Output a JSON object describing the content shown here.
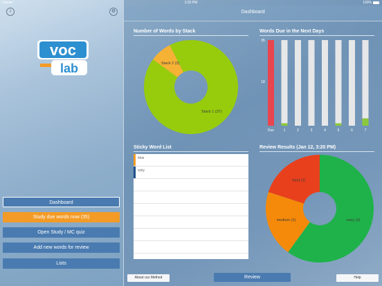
{
  "status": {
    "carrier": "Carrier",
    "time": "3:20 PM",
    "battery": "100%"
  },
  "sidebar": {
    "buttons": [
      {
        "label": "Dashboard",
        "style": "dash"
      },
      {
        "label": "Study due words now (35)",
        "style": "orange"
      },
      {
        "label": "Open Study / MC quiz",
        "style": "blue"
      },
      {
        "label": "Add new words for review",
        "style": "blue"
      },
      {
        "label": "Lists",
        "style": "blue"
      }
    ],
    "logo": {
      "top": "voc",
      "bottom": "lab"
    }
  },
  "header": {
    "title": "Dashboard"
  },
  "panels": {
    "stack_title": "Number of Words by Stack",
    "due_title": "Words Due in the Next Days",
    "sticky_title": "Sticky Word List",
    "review_title": "Review Results (Jan 12, 3:20 PM)"
  },
  "sticky": {
    "items": [
      {
        "word": "blue",
        "color": "#f39b26"
      },
      {
        "word": "sixty",
        "color": "#1f4f8a"
      }
    ]
  },
  "bottom": {
    "about": "About our Method",
    "review": "Review",
    "help": "Help"
  },
  "colors": {
    "orange": "#f39b26",
    "green": "#97cc0c",
    "red": "#e8454f",
    "darkgreen": "#1fb24a",
    "donut_red": "#e8401c"
  },
  "chart_data": [
    {
      "type": "pie",
      "title": "Number of Words by Stack",
      "labels": [
        "Stack 1 (37)",
        "Stack 2 (3)"
      ],
      "values": [
        37,
        3
      ],
      "colors": [
        "#97cc0c",
        "#f6b234"
      ]
    },
    {
      "type": "bar",
      "title": "Words Due in the Next Days",
      "categories": [
        "Due",
        "1",
        "2",
        "3",
        "4",
        "5",
        "6",
        "7"
      ],
      "values": [
        35,
        1,
        0,
        0,
        0,
        1,
        0,
        3
      ],
      "ylim": [
        0,
        35
      ],
      "yticks": [
        "35",
        "18"
      ]
    },
    {
      "type": "pie",
      "title": "Review Results (Jan 12, 3:20 PM)",
      "labels": [
        "easy (3)",
        "medium (1)",
        "hard (1)"
      ],
      "values": [
        3,
        1,
        1
      ],
      "colors": [
        "#1fb24a",
        "#f58a0a",
        "#e8401c"
      ]
    }
  ]
}
